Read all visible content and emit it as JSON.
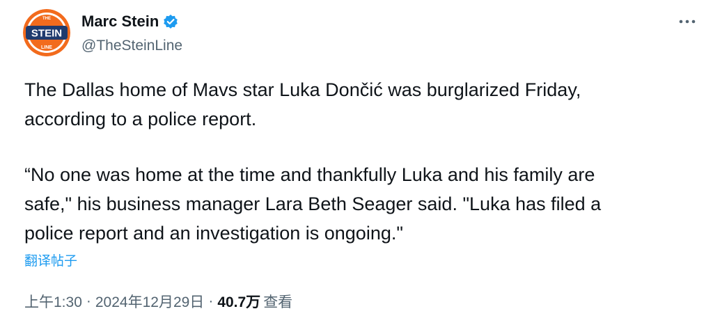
{
  "author": {
    "display_name": "Marc Stein",
    "handle": "@TheSteinLine",
    "avatar_text": "STEIN",
    "avatar_subtext": "LINE",
    "verified": true
  },
  "tweet": {
    "paragraphs": [
      "The Dallas home of Mavs star Luka Dončić was burglarized Friday,\naccording to a police report.",
      "“No one was home at the time and thankfully Luka and his family are\nsafe,\" his business manager Lara Beth Seager said. \"Luka has filed a\npolice report and an investigation is ongoing.\""
    ],
    "translate_label": "翻译帖子"
  },
  "meta": {
    "time": "上午1:30",
    "separator": "·",
    "date": "2024年12月29日",
    "views_count": "40.7万",
    "views_label": "查看"
  },
  "colors": {
    "accent": "#1d9bf0",
    "text_primary": "#0f1419",
    "text_secondary": "#536471",
    "avatar_orange": "#f26b1d",
    "avatar_navy": "#1f3b6e"
  },
  "icons": {
    "verified": "verified-badge-icon",
    "more": "more-dots-icon"
  }
}
